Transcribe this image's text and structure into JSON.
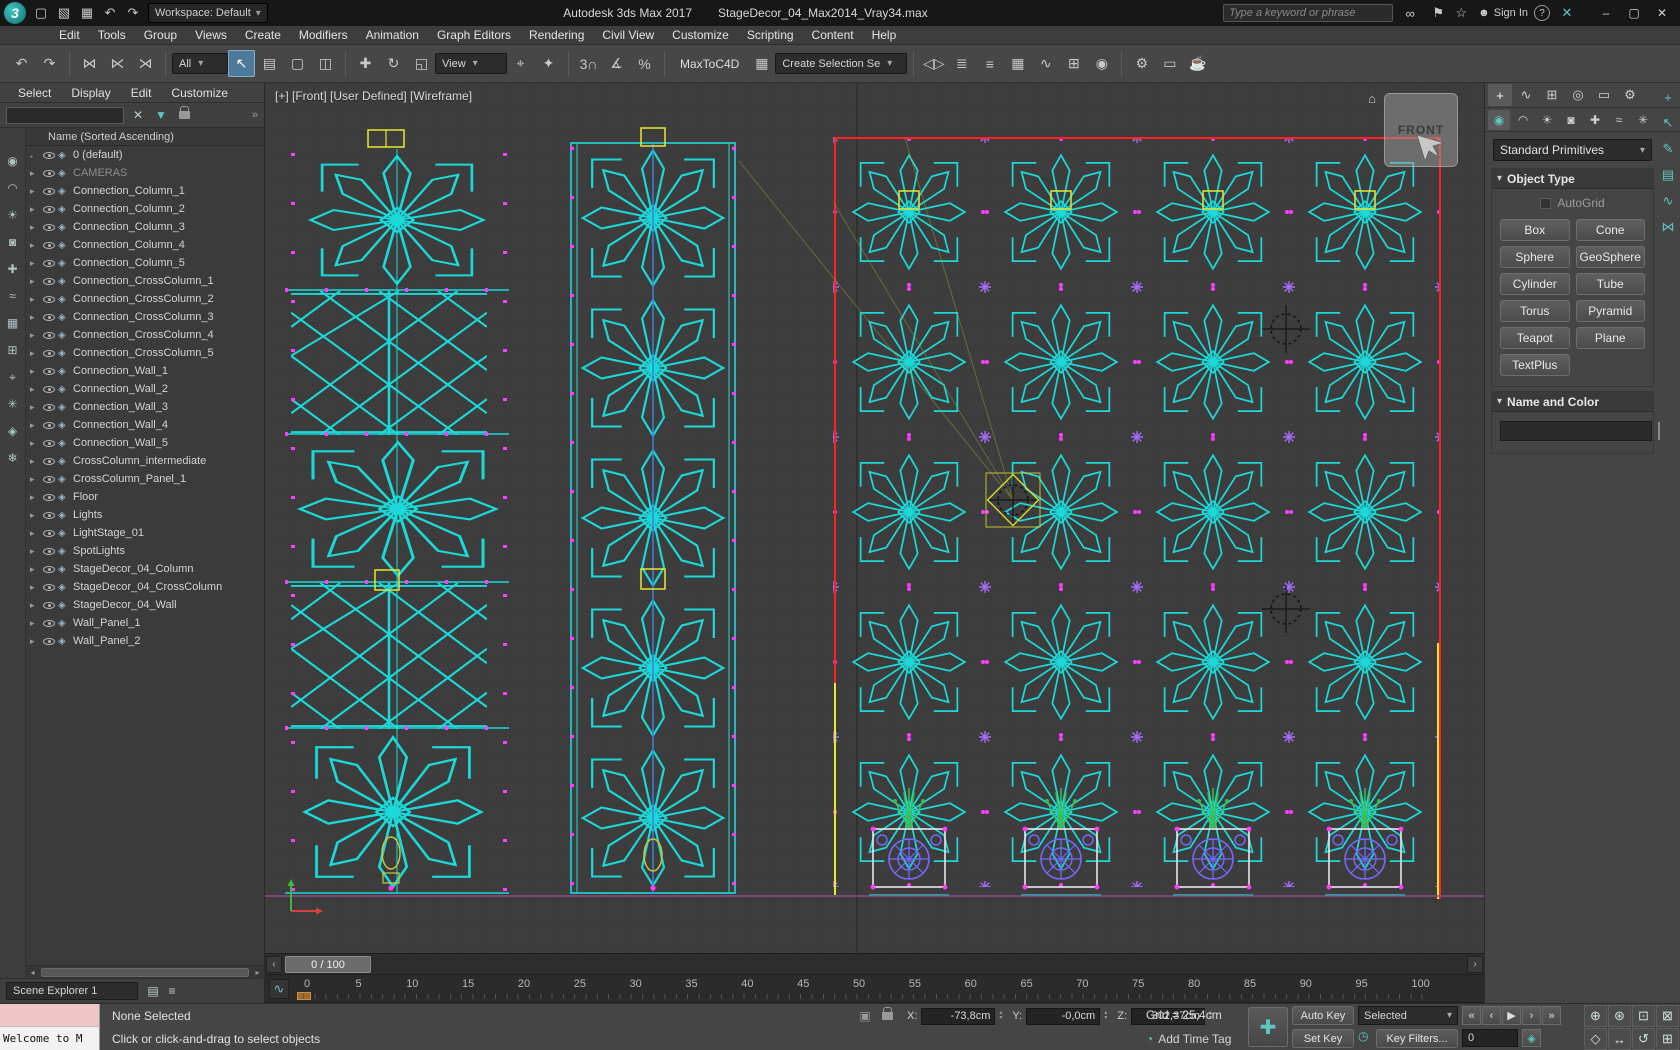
{
  "colors": {
    "accent_teal": "#5fc5c0",
    "wireframe_cyan": "#1bd9d9",
    "vertex_magenta": "#ff3cff",
    "selection_red": "#ff2222",
    "highlight_yellow": "#e8e832",
    "connector_violet": "#a76cff",
    "plant_green": "#3dbb4d",
    "ground_magenta": "#8a4d8a",
    "object_color_swatch": "#b32222"
  },
  "titlebar": {
    "logo": "3",
    "quick": [
      {
        "name": "new-scene-icon",
        "glyph": "▢"
      },
      {
        "name": "open-file-icon",
        "glyph": "▧"
      },
      {
        "name": "save-file-icon",
        "glyph": "▦"
      },
      {
        "name": "undo-icon",
        "glyph": "↶"
      },
      {
        "name": "redo-icon",
        "glyph": "↷"
      }
    ],
    "workspace": "Workspace: Default",
    "app_title": "Autodesk 3ds Max 2017",
    "doc_title": "StageDecor_04_Max2014_Vray34.max",
    "search_placeholder": "Type a keyword or phrase",
    "search_icon_glyph": "∞",
    "tools": [
      {
        "name": "communication-center-icon",
        "glyph": "⚑"
      },
      {
        "name": "favorites-star-icon",
        "glyph": "☆"
      }
    ],
    "signin_glyph": "☻",
    "signin": "Sign In",
    "help_glyph": "?",
    "exchange_glyph": "✕",
    "window": [
      {
        "name": "minimize-button",
        "glyph": "–"
      },
      {
        "name": "maximize-button",
        "glyph": "▢"
      },
      {
        "name": "close-button",
        "glyph": "✕"
      }
    ]
  },
  "menubar": [
    {
      "name": "menu-edit",
      "label": "Edit"
    },
    {
      "name": "menu-tools",
      "label": "Tools"
    },
    {
      "name": "menu-group",
      "label": "Group"
    },
    {
      "name": "menu-views",
      "label": "Views"
    },
    {
      "name": "menu-create",
      "label": "Create"
    },
    {
      "name": "menu-modifiers",
      "label": "Modifiers"
    },
    {
      "name": "menu-animation",
      "label": "Animation"
    },
    {
      "name": "menu-graph-editors",
      "label": "Graph Editors"
    },
    {
      "name": "menu-rendering",
      "label": "Rendering"
    },
    {
      "name": "menu-civil-view",
      "label": "Civil View"
    },
    {
      "name": "menu-customize",
      "label": "Customize"
    },
    {
      "name": "menu-scripting",
      "label": "Scripting"
    },
    {
      "name": "menu-content",
      "label": "Content"
    },
    {
      "name": "menu-help",
      "label": "Help"
    }
  ],
  "toolbar": {
    "filter_label": "All",
    "coord_label": "View",
    "maxtoc4d_label": "MaxToC4D",
    "selection_set_label": "Create Selection Se",
    "g1": [
      {
        "name": "undo-button",
        "glyph": "↶"
      },
      {
        "name": "redo-button",
        "glyph": "↷"
      }
    ],
    "g2": [
      {
        "name": "select-and-link-icon",
        "glyph": "⋈"
      },
      {
        "name": "unlink-selection-icon",
        "glyph": "⋉"
      },
      {
        "name": "bind-to-space-warp-icon",
        "glyph": "⋊"
      }
    ],
    "g4": [
      {
        "name": "select-object-button",
        "glyph": "↖",
        "cls": "active"
      },
      {
        "name": "select-by-name-button",
        "glyph": "▤"
      },
      {
        "name": "selection-region-button",
        "glyph": "▢"
      },
      {
        "name": "window-crossing-toggle",
        "glyph": "◫"
      }
    ],
    "g5": [
      {
        "name": "select-and-move-button",
        "glyph": "✚"
      },
      {
        "name": "select-and-rotate-button",
        "glyph": "↻"
      },
      {
        "name": "select-and-scale-button",
        "glyph": "◱"
      }
    ],
    "g6": [
      {
        "name": "use-pivot-center-button",
        "glyph": "⌖"
      },
      {
        "name": "select-and-manipulate-button",
        "glyph": "✦"
      }
    ],
    "g7": [
      {
        "name": "snaps-toggle",
        "glyph": "3∩"
      },
      {
        "name": "angle-snap-toggle",
        "glyph": "∡"
      },
      {
        "name": "percent-snap-toggle",
        "glyph": "%"
      }
    ],
    "g8": [
      {
        "name": "edit-named-selections-button",
        "glyph": "▦"
      }
    ],
    "g9": [
      {
        "name": "mirror-button",
        "glyph": "◁▷"
      },
      {
        "name": "align-button",
        "glyph": "≣"
      },
      {
        "name": "layer-manager-button",
        "glyph": "≡"
      },
      {
        "name": "ribbon-toggle-button",
        "glyph": "▦"
      },
      {
        "name": "curve-editor-button",
        "glyph": "∿"
      },
      {
        "name": "schematic-view-button",
        "glyph": "⊞"
      },
      {
        "name": "material-editor-button",
        "glyph": "◉"
      }
    ],
    "g10": [
      {
        "name": "render-setup-button",
        "glyph": "⚙"
      },
      {
        "name": "rendered-frame-button",
        "glyph": "▭"
      },
      {
        "name": "render-production-button",
        "glyph": "☕"
      }
    ]
  },
  "explorer": {
    "menu": [
      {
        "name": "explorer-menu-select",
        "label": "Select"
      },
      {
        "name": "explorer-menu-display",
        "label": "Display"
      },
      {
        "name": "explorer-menu-edit",
        "label": "Edit"
      },
      {
        "name": "explorer-menu-customize",
        "label": "Customize"
      }
    ],
    "clear_glyph": "✕",
    "filter_glyph": "▼",
    "chevron_glyph": "»",
    "header": "Name (Sorted Ascending)",
    "rail": [
      {
        "name": "filter-geometry-icon",
        "glyph": "◉"
      },
      {
        "name": "filter-shapes-icon",
        "glyph": "◠"
      },
      {
        "name": "filter-lights-icon",
        "glyph": "☀"
      },
      {
        "name": "filter-cameras-icon",
        "glyph": "◙"
      },
      {
        "name": "filter-helpers-icon",
        "glyph": "✚"
      },
      {
        "name": "filter-spacewarps-icon",
        "glyph": "≈"
      },
      {
        "name": "filter-groups-icon",
        "glyph": "▦"
      },
      {
        "name": "filter-xrefs-icon",
        "glyph": "⊞"
      },
      {
        "name": "filter-bones-icon",
        "glyph": "⌖"
      },
      {
        "name": "filter-particles-icon",
        "glyph": "✳"
      },
      {
        "name": "filter-materials-icon",
        "glyph": "◈"
      },
      {
        "name": "filter-frozen-icon",
        "glyph": "❄"
      }
    ],
    "rows": [
      {
        "label": "0 (default)",
        "cls": "noarrow"
      },
      {
        "label": "CAMERAS",
        "cls": "dim"
      },
      {
        "label": "Connection_Column_1"
      },
      {
        "label": "Connection_Column_2"
      },
      {
        "label": "Connection_Column_3"
      },
      {
        "label": "Connection_Column_4"
      },
      {
        "label": "Connection_Column_5"
      },
      {
        "label": "Connection_CrossColumn_1"
      },
      {
        "label": "Connection_CrossColumn_2"
      },
      {
        "label": "Connection_CrossColumn_3"
      },
      {
        "label": "Connection_CrossColumn_4"
      },
      {
        "label": "Connection_CrossColumn_5"
      },
      {
        "label": "Connection_Wall_1"
      },
      {
        "label": "Connection_Wall_2"
      },
      {
        "label": "Connection_Wall_3"
      },
      {
        "label": "Connection_Wall_4"
      },
      {
        "label": "Connection_Wall_5"
      },
      {
        "label": "CrossColumn_intermediate"
      },
      {
        "label": "CrossColumn_Panel_1"
      },
      {
        "label": "Floor"
      },
      {
        "label": "Lights"
      },
      {
        "label": "LightStage_01"
      },
      {
        "label": "SpotLights"
      },
      {
        "label": "StageDecor_04_Column"
      },
      {
        "label": "StageDecor_04_CrossColumn"
      },
      {
        "label": "StageDecor_04_Wall"
      },
      {
        "label": "Wall_Panel_1"
      },
      {
        "label": "Wall_Panel_2"
      }
    ],
    "footer": "Scene Explorer 1",
    "footer_icons": [
      {
        "name": "explorer-layers-icon",
        "glyph": "▤"
      },
      {
        "name": "explorer-menu-icon",
        "glyph": "≡"
      }
    ]
  },
  "viewport": {
    "label": "[+] [Front] [User Defined] [Wireframe]",
    "viewcube": "FRONT",
    "viewcube_home_glyph": "⌂"
  },
  "panel": {
    "tabs": [
      {
        "name": "tab-create",
        "glyph": "+",
        "cls": "active"
      },
      {
        "name": "tab-modify",
        "glyph": "∿"
      },
      {
        "name": "tab-hierarchy",
        "glyph": "⊞"
      },
      {
        "name": "tab-motion",
        "glyph": "◎"
      },
      {
        "name": "tab-display",
        "glyph": "▭"
      },
      {
        "name": "tab-utilities",
        "glyph": "⚙"
      }
    ],
    "cats": [
      {
        "name": "category-geometry",
        "glyph": "◉",
        "cls": "active"
      },
      {
        "name": "category-shapes",
        "glyph": "◠"
      },
      {
        "name": "category-lights",
        "glyph": "☀"
      },
      {
        "name": "category-cameras",
        "glyph": "◙"
      },
      {
        "name": "category-helpers",
        "glyph": "✚"
      },
      {
        "name": "category-spacewarps",
        "glyph": "≈"
      },
      {
        "name": "category-systems",
        "glyph": "✳"
      }
    ],
    "rail": [
      {
        "name": "rail-add-icon",
        "glyph": "+"
      },
      {
        "name": "rail-select-icon",
        "glyph": "↖"
      },
      {
        "name": "rail-pencil-icon",
        "glyph": "✎"
      },
      {
        "name": "rail-layers-icon",
        "glyph": "▤"
      },
      {
        "name": "rail-curve-icon",
        "glyph": "∿"
      },
      {
        "name": "rail-link-icon",
        "glyph": "⋈"
      }
    ],
    "category_dropdown": "Standard Primitives",
    "object_type_rollout": "Object Type",
    "autogrid": "AutoGrid",
    "object_buttons": [
      {
        "name": "box-button",
        "label": "Box"
      },
      {
        "name": "cone-button",
        "label": "Cone"
      },
      {
        "name": "sphere-button",
        "label": "Sphere"
      },
      {
        "name": "geosphere-button",
        "label": "GeoSphere"
      },
      {
        "name": "cylinder-button",
        "label": "Cylinder"
      },
      {
        "name": "tube-button",
        "label": "Tube"
      },
      {
        "name": "torus-button",
        "label": "Torus"
      },
      {
        "name": "pyramid-button",
        "label": "Pyramid"
      },
      {
        "name": "teapot-button",
        "label": "Teapot"
      },
      {
        "name": "plane-button",
        "label": "Plane"
      },
      {
        "name": "textplus-button",
        "label": "TextPlus"
      }
    ],
    "name_color_rollout": "Name and Color"
  },
  "timeline": {
    "frame": "0 / 100",
    "left_arrow": "‹",
    "right_arrow": "›",
    "mini_curve_glyph": "∿",
    "ticks": [
      {
        "label": "0"
      },
      {
        "label": "5"
      },
      {
        "label": "10"
      },
      {
        "label": "15"
      },
      {
        "label": "20"
      },
      {
        "label": "25"
      },
      {
        "label": "30"
      },
      {
        "label": "35"
      },
      {
        "label": "40"
      },
      {
        "label": "45"
      },
      {
        "label": "50"
      },
      {
        "label": "55"
      },
      {
        "label": "60"
      },
      {
        "label": "65"
      },
      {
        "label": "70"
      },
      {
        "label": "75"
      },
      {
        "label": "80"
      },
      {
        "label": "85"
      },
      {
        "label": "90"
      },
      {
        "label": "95"
      },
      {
        "label": "100"
      }
    ]
  },
  "statusbar": {
    "listener_text": "Welcome to M",
    "selection_status": "None Selected",
    "prompt": "Click or click-and-drag to select objects",
    "x_label": "X:",
    "x_value": "-73,8cm",
    "y_label": "Y:",
    "y_value": "-0,0cm",
    "z_label": "Z:",
    "z_value": "302,37cm",
    "grid_text": "Grid = 25,4cm",
    "time_tag_glyph": "◔",
    "add_time_tag": "Add Time Tag",
    "bigbtn_glyph": "✚",
    "auto_key": "Auto Key",
    "set_key": "Set Key",
    "selected_dropdown": "Selected",
    "key_filters_glyph": "◷",
    "key_filters": "Key Filters...",
    "frame_field": "0",
    "key_mode_glyph": "◈",
    "playback": [
      {
        "name": "go-to-start-button",
        "glyph": "«"
      },
      {
        "name": "previous-frame-button",
        "glyph": "‹"
      },
      {
        "name": "play-button",
        "glyph": "▶"
      },
      {
        "name": "next-frame-button",
        "glyph": "›"
      },
      {
        "name": "go-to-end-button",
        "glyph": "»"
      }
    ],
    "nav": [
      {
        "name": "zoom-icon",
        "glyph": "⊕"
      },
      {
        "name": "zoom-all-icon",
        "glyph": "⊛"
      },
      {
        "name": "zoom-extents-icon",
        "glyph": "⊡"
      },
      {
        "name": "zoom-region-icon",
        "glyph": "⊠"
      },
      {
        "name": "field-of-view-icon",
        "glyph": "◇"
      },
      {
        "name": "pan-icon",
        "glyph": "↔"
      },
      {
        "name": "orbit-icon",
        "glyph": "↺"
      },
      {
        "name": "maximize-viewport-icon",
        "glyph": "⊞"
      }
    ]
  }
}
